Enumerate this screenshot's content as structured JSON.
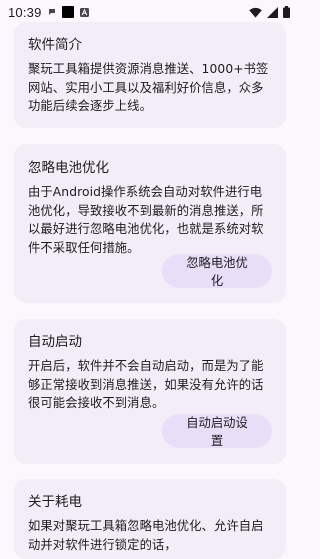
{
  "status_bar": {
    "time": "10:39",
    "icons": [
      "chat-bubble-icon",
      "black-square-icon",
      "a-badge-icon",
      "wifi-icon",
      "signal-icon",
      "battery-icon"
    ]
  },
  "cards": [
    {
      "title": "软件简介",
      "body": "聚玩工具箱提供资源消息推送、1000+书签网站、实用小工具以及福利好价信息，众多功能后续会逐步上线。"
    },
    {
      "title": "忽略电池优化",
      "body": "由于Android操作系统会自动对软件进行电池优化，导致接收不到最新的消息推送，所以最好进行忽略电池优化，也就是系统对软件不采取任何措施。",
      "button": "忽略电池优化"
    },
    {
      "title": "自动启动",
      "body": "开启后，软件并不会自动启动，而是为了能够正常接收到消息推送，如果没有允许的话很可能会接收不到消息。",
      "button": "自动启动设置"
    },
    {
      "title": "关于耗电",
      "body": "如果对聚玩工具箱忽略电池优化、允许自启动并对软件进行锁定的话，"
    }
  ]
}
